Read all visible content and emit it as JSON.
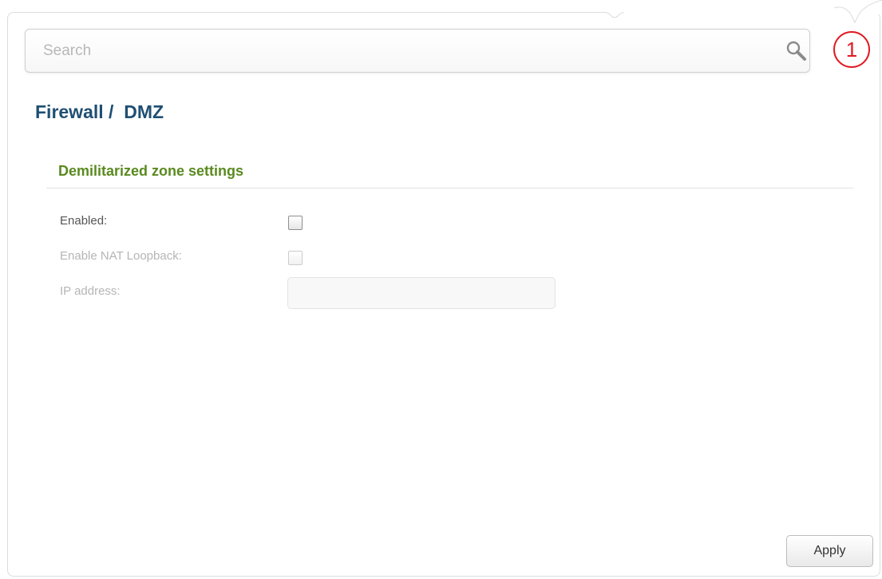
{
  "search": {
    "placeholder": "Search",
    "value": "",
    "icon": "search-icon"
  },
  "notifications": {
    "count": "1",
    "icon": "notification-badge",
    "color": "#e01b24"
  },
  "page": {
    "breadcrumb": "Firewall /  DMZ"
  },
  "section": {
    "title": "Demilitarized zone settings"
  },
  "form": {
    "enabled": {
      "label": "Enabled:",
      "checked": false,
      "disabled": false
    },
    "nat_loopback": {
      "label": "Enable NAT Loopback:",
      "checked": false,
      "disabled": true
    },
    "ip_address": {
      "label": "IP address:",
      "value": "",
      "disabled": true
    }
  },
  "actions": {
    "apply_label": "Apply"
  },
  "colors": {
    "breadcrumb": "#1f4f73",
    "section_title": "#5a8a1f",
    "label_active": "#555555",
    "label_disabled": "#b5b5b5"
  }
}
